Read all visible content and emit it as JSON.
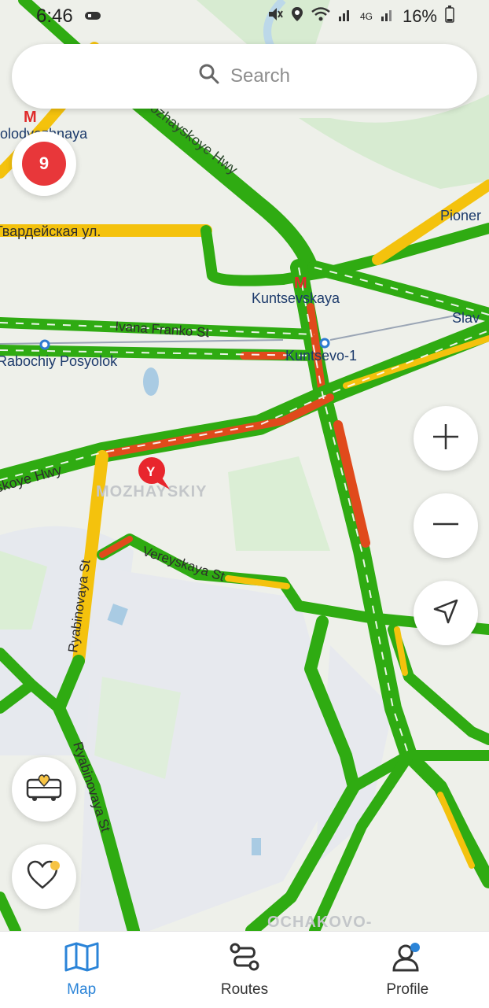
{
  "status_bar": {
    "time": "6:46",
    "battery": "16%",
    "network": "4G"
  },
  "search": {
    "placeholder": "Search"
  },
  "traffic_level": "9",
  "map": {
    "labels": {
      "metro_top_left": "olodyozhnaya",
      "road_top": "Mozhayskoye Hwy",
      "road_guard": "Гвардейская ул.",
      "metro_center": "Kuntsevskaya",
      "metro_right1": "Pioner",
      "metro_right2": "Slav",
      "street_ivana": "Ivana Franko St",
      "rail_left": "Rabochiy Posyolok",
      "rail_center": "Kuntsevo-1",
      "road_left": "skoye Hwy",
      "district": "MOZHAYSKIY",
      "street_ryab1": "Ryabinovaya St",
      "street_vereysk": "Vereyskaya St",
      "street_ryab2": "Ryabinovaya St",
      "district_bottom": "OCHAKOVO-"
    },
    "colors": {
      "traffic_free": "#2fab12",
      "traffic_slow": "#f4c20d",
      "traffic_jam": "#e04a1c",
      "background": "#eef0ea"
    }
  },
  "controls": {
    "zoom_in_icon": "plus-icon",
    "zoom_out_icon": "minus-icon",
    "locate_icon": "navigation-arrow-icon",
    "transport_icon": "bus-heart-icon",
    "favorites_icon": "heart-icon"
  },
  "bottom_nav": {
    "items": [
      {
        "label": "Map",
        "icon": "map-icon",
        "active": true
      },
      {
        "label": "Routes",
        "icon": "routes-icon",
        "active": false
      },
      {
        "label": "Profile",
        "icon": "profile-icon",
        "active": false
      }
    ]
  }
}
